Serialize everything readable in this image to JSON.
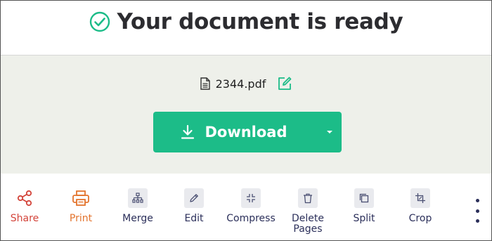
{
  "header": {
    "title": "Your document is ready"
  },
  "file": {
    "name": "2344.pdf"
  },
  "download": {
    "label": "Download"
  },
  "toolbar": {
    "items": [
      {
        "label": "Share"
      },
      {
        "label": "Print"
      },
      {
        "label": "Merge"
      },
      {
        "label": "Edit"
      },
      {
        "label": "Compress"
      },
      {
        "label": "Delete Pages"
      },
      {
        "label": "Split"
      },
      {
        "label": "Crop"
      }
    ]
  },
  "colors": {
    "accent": "#1cbc88",
    "share": "#d3443a",
    "print": "#e3742e",
    "tool_text": "#2b2f5a"
  }
}
